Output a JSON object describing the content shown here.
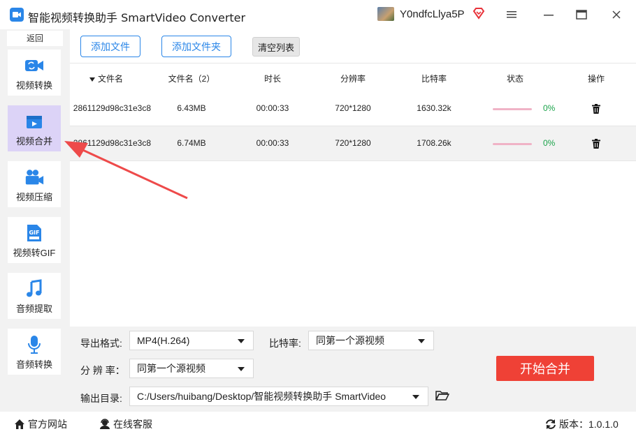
{
  "app": {
    "title": "智能视频转换助手 SmartVideo Converter",
    "username": "Y0ndfcLlya5P"
  },
  "sidebar": {
    "back_label": "返回",
    "items": [
      {
        "label": "视频转换",
        "icon": "video-convert-icon",
        "active": false
      },
      {
        "label": "视频合并",
        "icon": "video-merge-icon",
        "active": true
      },
      {
        "label": "视频压缩",
        "icon": "video-compress-icon",
        "active": false
      },
      {
        "label": "视频转GIF",
        "icon": "gif-icon",
        "active": false
      },
      {
        "label": "音频提取",
        "icon": "music-note-icon",
        "active": false
      },
      {
        "label": "音频转换",
        "icon": "microphone-icon",
        "active": false
      }
    ]
  },
  "toolbar": {
    "add_file": "添加文件",
    "add_folder": "添加文件夹",
    "clear_list": "清空列表"
  },
  "table": {
    "headers": [
      "文件名",
      "文件名（2）",
      "时长",
      "分辨率",
      "比特率",
      "状态",
      "操作"
    ],
    "rows": [
      {
        "filename": "2861129d98c31e3c8",
        "size": "6.43MB",
        "duration": "00:00:33",
        "resolution": "720*1280",
        "bitrate": "1630.32k",
        "progress": 0,
        "progress_text": "0%"
      },
      {
        "filename": "2861129d98c31e3c8",
        "size": "6.74MB",
        "duration": "00:00:33",
        "resolution": "720*1280",
        "bitrate": "1708.26k",
        "progress": 0,
        "progress_text": "0%"
      }
    ]
  },
  "settings": {
    "format_label": "导出格式:",
    "format_value": "MP4(H.264)",
    "bitrate_label": "比特率:",
    "bitrate_value": "同第一个源视频",
    "resolution_label": "分 辨 率：",
    "resolution_value": "同第一个源视频",
    "output_label": "输出目录:",
    "output_value": "C:/Users/huibang/Desktop/智能视频转换助手 SmartVideo",
    "start_label": "开始合并"
  },
  "statusbar": {
    "website": "官方网站",
    "support": "在线客服",
    "version": "版本：1.0.1.0"
  },
  "colors": {
    "accent": "#2a86e8",
    "start": "#ef4136",
    "active_sidebar": "#dcd3f7",
    "progress_ok": "#1aa34a",
    "progress_track": "#f0b3c6",
    "annotation_arrow": "#ee4a4a"
  }
}
